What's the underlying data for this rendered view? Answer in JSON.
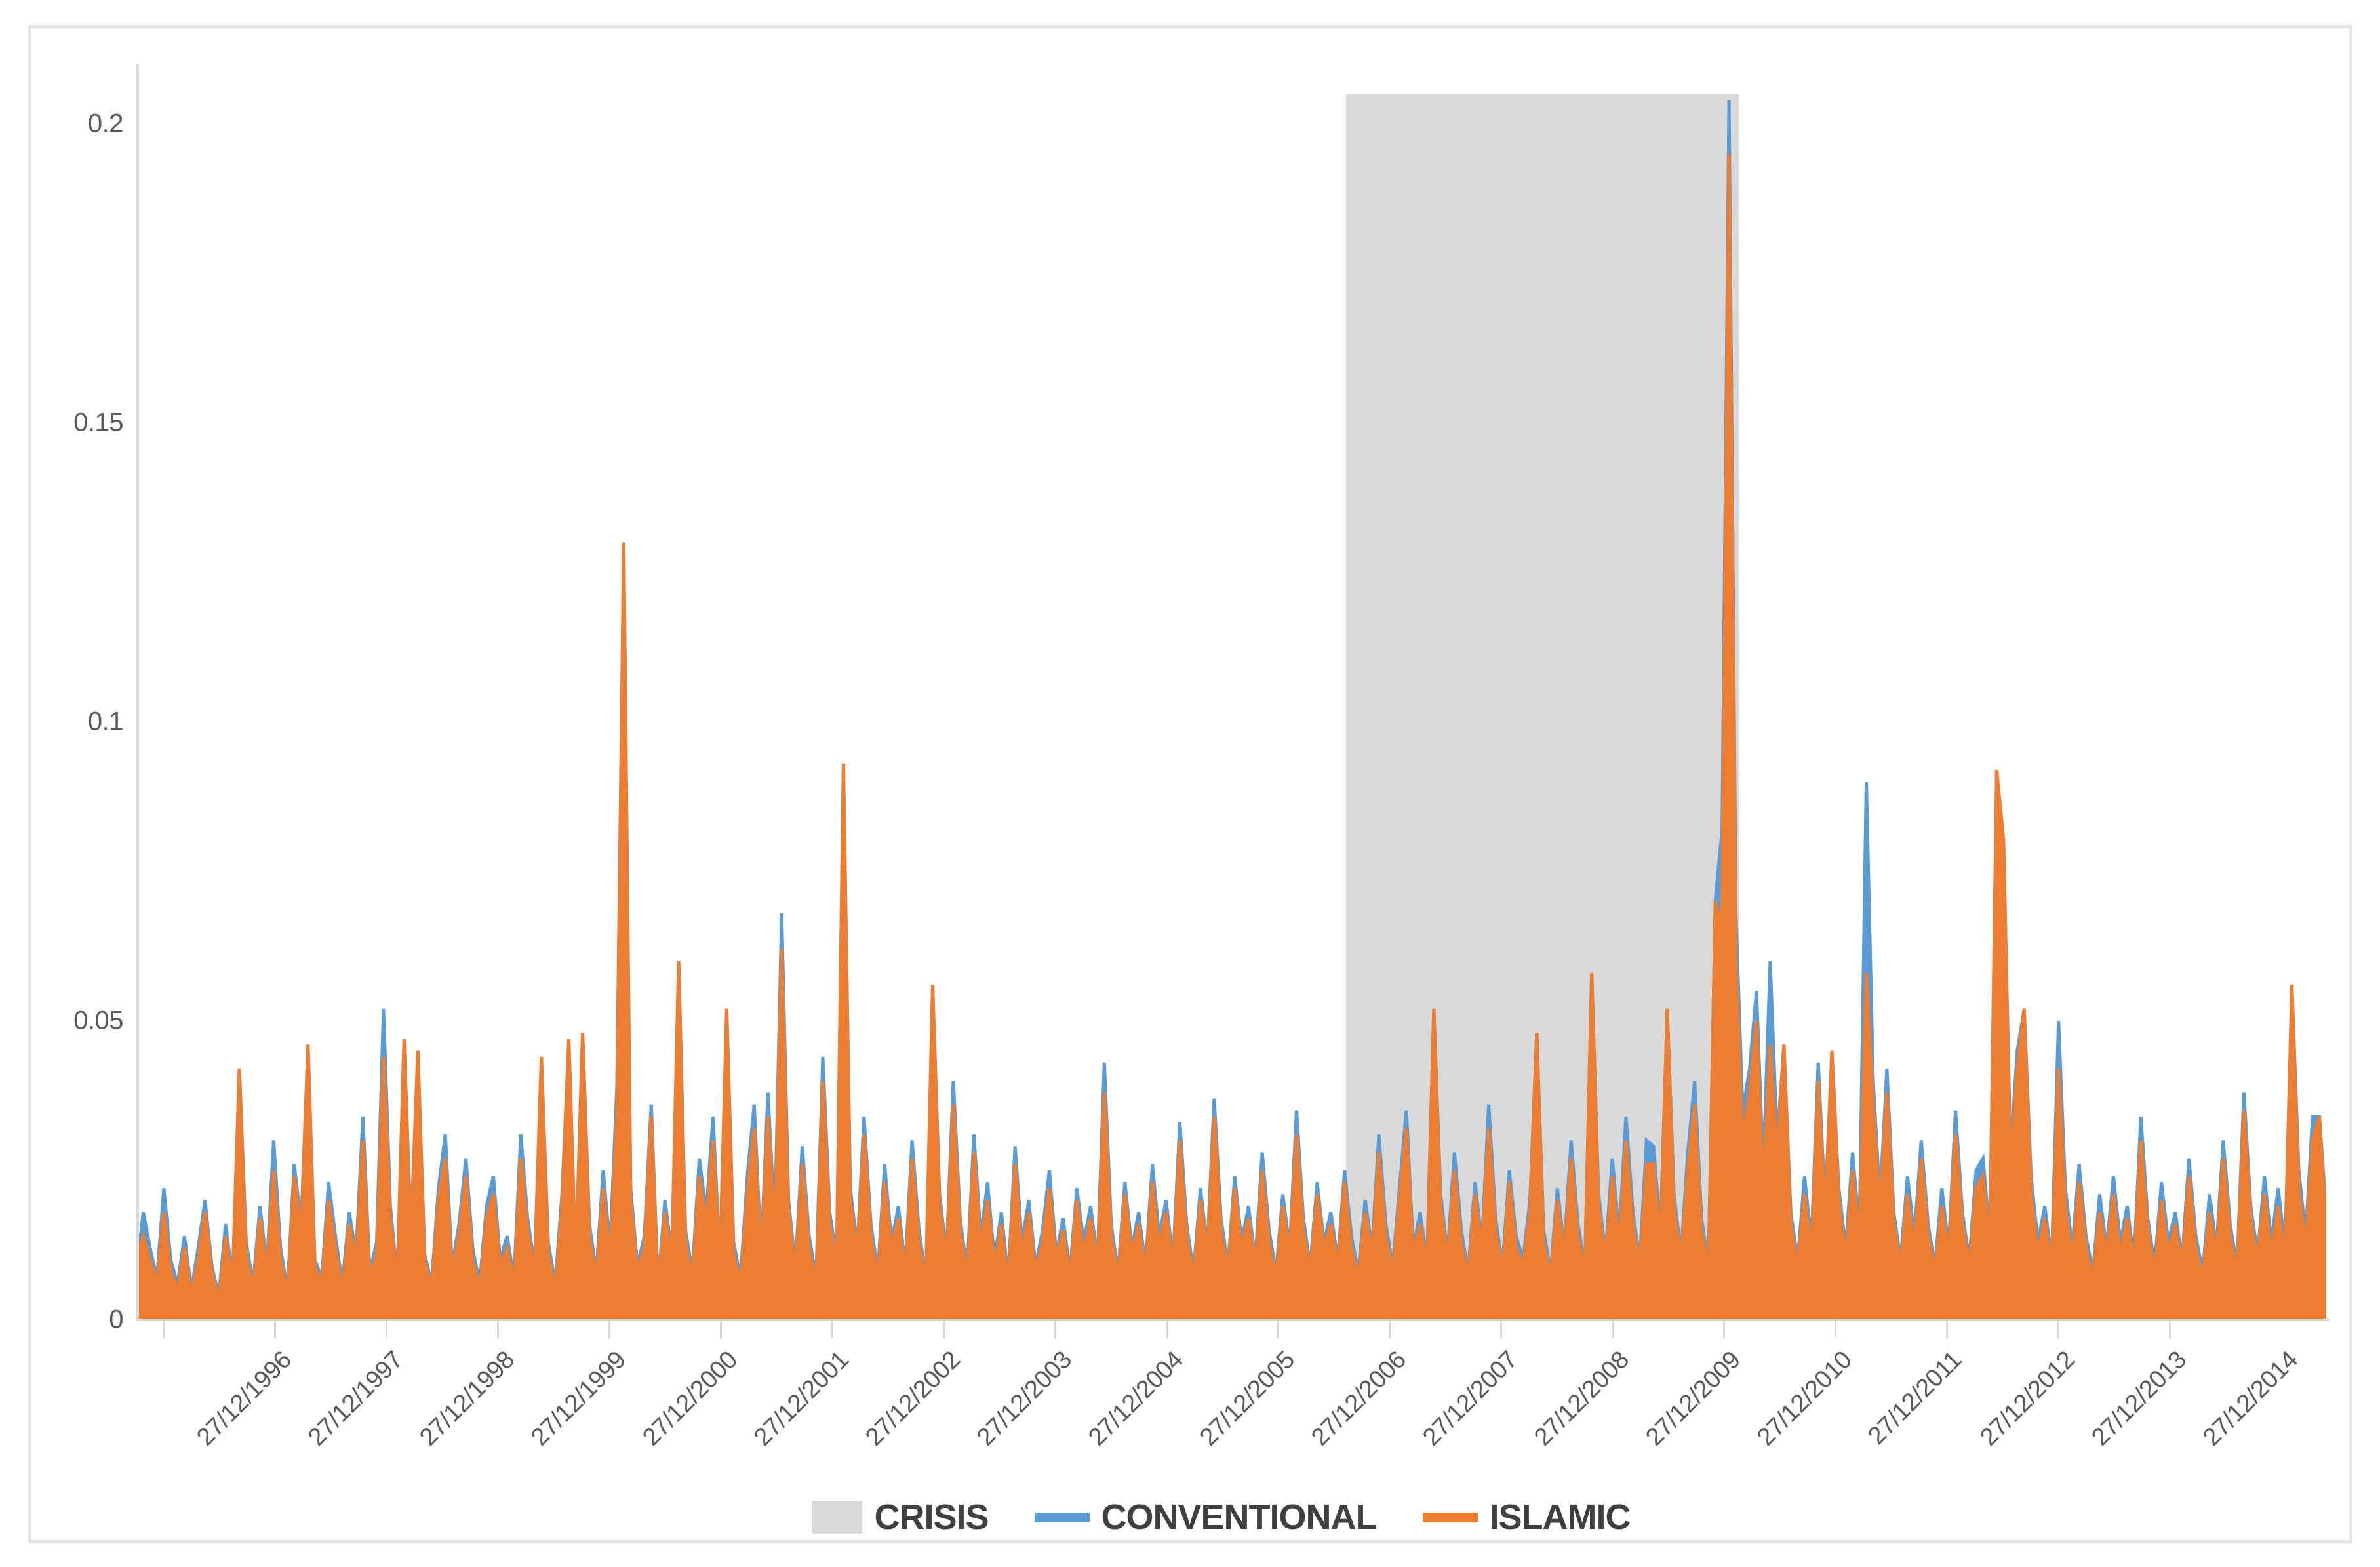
{
  "chart_data": {
    "type": "line",
    "title": "",
    "xlabel": "",
    "ylabel": "",
    "ylim": [
      0,
      0.21
    ],
    "grid": false,
    "legend_position": "bottom",
    "y_ticks": [
      "0",
      "0.05",
      "0.1",
      "0.15",
      "0.2"
    ],
    "y_tick_values": [
      0,
      0.05,
      0.1,
      0.15,
      0.2
    ],
    "x_tick_labels": [
      "27/12/1996",
      "27/12/1997",
      "27/12/1998",
      "27/12/1999",
      "27/12/2000",
      "27/12/2001",
      "27/12/2002",
      "27/12/2003",
      "27/12/2004",
      "27/12/2005",
      "27/12/2006",
      "27/12/2007",
      "27/12/2008",
      "27/12/2009",
      "27/12/2010",
      "27/12/2011",
      "27/12/2012",
      "27/12/2013",
      "27/12/2014"
    ],
    "shaded_region": {
      "name": "CRISIS",
      "label": "CRISIS",
      "color": "#d9d9d9",
      "x_start_label": "mid 2007",
      "x_end_label": "mid 2010",
      "y_top": 0.205
    },
    "series": [
      {
        "name": "CONVENTIONAL",
        "label": "CONVENTIONAL",
        "color": "#5b9bd5",
        "max_value": 0.204,
        "max_value_at": "early 2008",
        "values": [
          0.008,
          0.018,
          0.012,
          0.007,
          0.022,
          0.01,
          0.006,
          0.014,
          0.005,
          0.012,
          0.02,
          0.009,
          0.004,
          0.016,
          0.007,
          0.042,
          0.013,
          0.006,
          0.019,
          0.009,
          0.03,
          0.012,
          0.005,
          0.026,
          0.016,
          0.046,
          0.01,
          0.007,
          0.023,
          0.014,
          0.006,
          0.018,
          0.011,
          0.034,
          0.008,
          0.013,
          0.052,
          0.019,
          0.007,
          0.047,
          0.015,
          0.045,
          0.011,
          0.006,
          0.022,
          0.031,
          0.009,
          0.016,
          0.027,
          0.012,
          0.006,
          0.019,
          0.024,
          0.01,
          0.014,
          0.007,
          0.031,
          0.017,
          0.009,
          0.044,
          0.013,
          0.006,
          0.021,
          0.047,
          0.01,
          0.048,
          0.016,
          0.008,
          0.025,
          0.012,
          0.039,
          0.13,
          0.022,
          0.009,
          0.014,
          0.036,
          0.006,
          0.02,
          0.011,
          0.06,
          0.015,
          0.008,
          0.027,
          0.018,
          0.034,
          0.01,
          0.052,
          0.013,
          0.007,
          0.024,
          0.036,
          0.011,
          0.038,
          0.016,
          0.068,
          0.02,
          0.009,
          0.029,
          0.014,
          0.007,
          0.044,
          0.018,
          0.01,
          0.093,
          0.022,
          0.012,
          0.034,
          0.016,
          0.008,
          0.026,
          0.013,
          0.019,
          0.009,
          0.03,
          0.015,
          0.007,
          0.056,
          0.021,
          0.011,
          0.04,
          0.017,
          0.008,
          0.031,
          0.014,
          0.023,
          0.01,
          0.018,
          0.007,
          0.029,
          0.013,
          0.02,
          0.009,
          0.015,
          0.025,
          0.011,
          0.017,
          0.008,
          0.022,
          0.013,
          0.019,
          0.01,
          0.043,
          0.016,
          0.008,
          0.023,
          0.012,
          0.018,
          0.009,
          0.026,
          0.014,
          0.02,
          0.01,
          0.033,
          0.016,
          0.008,
          0.022,
          0.012,
          0.037,
          0.017,
          0.009,
          0.024,
          0.013,
          0.019,
          0.01,
          0.028,
          0.015,
          0.008,
          0.021,
          0.012,
          0.035,
          0.017,
          0.009,
          0.023,
          0.013,
          0.018,
          0.01,
          0.025,
          0.014,
          0.008,
          0.02,
          0.012,
          0.031,
          0.016,
          0.009,
          0.022,
          0.035,
          0.012,
          0.018,
          0.01,
          0.052,
          0.021,
          0.011,
          0.028,
          0.015,
          0.008,
          0.023,
          0.013,
          0.036,
          0.017,
          0.009,
          0.025,
          0.014,
          0.01,
          0.02,
          0.048,
          0.015,
          0.008,
          0.022,
          0.012,
          0.03,
          0.016,
          0.009,
          0.058,
          0.021,
          0.011,
          0.027,
          0.014,
          0.034,
          0.018,
          0.01,
          0.03,
          0.029,
          0.015,
          0.052,
          0.021,
          0.011,
          0.028,
          0.04,
          0.017,
          0.009,
          0.07,
          0.082,
          0.204,
          0.068,
          0.035,
          0.042,
          0.055,
          0.025,
          0.06,
          0.03,
          0.046,
          0.018,
          0.01,
          0.024,
          0.013,
          0.043,
          0.019,
          0.045,
          0.022,
          0.012,
          0.028,
          0.015,
          0.09,
          0.04,
          0.02,
          0.042,
          0.018,
          0.01,
          0.024,
          0.014,
          0.03,
          0.016,
          0.009,
          0.022,
          0.012,
          0.035,
          0.018,
          0.01,
          0.025,
          0.027,
          0.014,
          0.092,
          0.08,
          0.028,
          0.045,
          0.052,
          0.024,
          0.013,
          0.019,
          0.01,
          0.05,
          0.022,
          0.012,
          0.026,
          0.014,
          0.008,
          0.021,
          0.012,
          0.024,
          0.013,
          0.019,
          0.01,
          0.034,
          0.017,
          0.009,
          0.023,
          0.013,
          0.018,
          0.01,
          0.027,
          0.014,
          0.008,
          0.021,
          0.012,
          0.03,
          0.016,
          0.009,
          0.038,
          0.019,
          0.011,
          0.024,
          0.013,
          0.022,
          0.012,
          0.056,
          0.025,
          0.014,
          0.034,
          0.034,
          0.018
        ]
      },
      {
        "name": "ISLAMIC",
        "label": "ISLAMIC",
        "color": "#ed7d31",
        "max_value": 0.195,
        "max_value_at": "early 2008",
        "values": [
          0.01,
          0.014,
          0.01,
          0.006,
          0.018,
          0.008,
          0.005,
          0.012,
          0.004,
          0.01,
          0.018,
          0.008,
          0.003,
          0.014,
          0.006,
          0.042,
          0.011,
          0.005,
          0.017,
          0.008,
          0.025,
          0.01,
          0.004,
          0.024,
          0.014,
          0.046,
          0.009,
          0.006,
          0.02,
          0.012,
          0.005,
          0.016,
          0.01,
          0.03,
          0.007,
          0.011,
          0.044,
          0.017,
          0.006,
          0.047,
          0.013,
          0.045,
          0.01,
          0.005,
          0.02,
          0.027,
          0.008,
          0.014,
          0.024,
          0.01,
          0.005,
          0.017,
          0.021,
          0.009,
          0.012,
          0.006,
          0.027,
          0.015,
          0.008,
          0.044,
          0.011,
          0.005,
          0.019,
          0.047,
          0.009,
          0.048,
          0.014,
          0.007,
          0.022,
          0.01,
          0.034,
          0.13,
          0.02,
          0.008,
          0.012,
          0.034,
          0.005,
          0.018,
          0.01,
          0.06,
          0.013,
          0.007,
          0.024,
          0.016,
          0.03,
          0.009,
          0.052,
          0.011,
          0.006,
          0.021,
          0.032,
          0.01,
          0.034,
          0.014,
          0.062,
          0.018,
          0.008,
          0.026,
          0.012,
          0.006,
          0.04,
          0.016,
          0.009,
          0.093,
          0.02,
          0.011,
          0.031,
          0.014,
          0.007,
          0.023,
          0.012,
          0.017,
          0.008,
          0.027,
          0.013,
          0.006,
          0.056,
          0.019,
          0.01,
          0.036,
          0.015,
          0.007,
          0.028,
          0.012,
          0.02,
          0.009,
          0.016,
          0.006,
          0.026,
          0.011,
          0.018,
          0.008,
          0.013,
          0.022,
          0.01,
          0.015,
          0.007,
          0.02,
          0.011,
          0.017,
          0.009,
          0.038,
          0.014,
          0.007,
          0.021,
          0.011,
          0.016,
          0.008,
          0.023,
          0.012,
          0.018,
          0.009,
          0.03,
          0.014,
          0.007,
          0.02,
          0.011,
          0.034,
          0.015,
          0.008,
          0.022,
          0.012,
          0.017,
          0.009,
          0.025,
          0.013,
          0.007,
          0.019,
          0.011,
          0.031,
          0.015,
          0.008,
          0.021,
          0.012,
          0.016,
          0.009,
          0.023,
          0.012,
          0.007,
          0.018,
          0.011,
          0.028,
          0.014,
          0.008,
          0.02,
          0.032,
          0.011,
          0.016,
          0.009,
          0.052,
          0.019,
          0.01,
          0.025,
          0.013,
          0.007,
          0.021,
          0.012,
          0.032,
          0.015,
          0.008,
          0.023,
          0.012,
          0.009,
          0.018,
          0.048,
          0.013,
          0.007,
          0.02,
          0.011,
          0.027,
          0.014,
          0.008,
          0.058,
          0.019,
          0.01,
          0.024,
          0.012,
          0.03,
          0.016,
          0.009,
          0.026,
          0.026,
          0.013,
          0.052,
          0.019,
          0.01,
          0.025,
          0.036,
          0.015,
          0.008,
          0.07,
          0.066,
          0.195,
          0.06,
          0.03,
          0.038,
          0.05,
          0.022,
          0.046,
          0.027,
          0.046,
          0.016,
          0.009,
          0.021,
          0.011,
          0.04,
          0.017,
          0.045,
          0.02,
          0.01,
          0.025,
          0.013,
          0.058,
          0.036,
          0.018,
          0.038,
          0.016,
          0.009,
          0.021,
          0.012,
          0.027,
          0.014,
          0.008,
          0.019,
          0.011,
          0.031,
          0.016,
          0.009,
          0.022,
          0.024,
          0.012,
          0.092,
          0.08,
          0.025,
          0.042,
          0.052,
          0.021,
          0.011,
          0.017,
          0.009,
          0.042,
          0.019,
          0.01,
          0.023,
          0.012,
          0.007,
          0.018,
          0.011,
          0.021,
          0.011,
          0.017,
          0.009,
          0.03,
          0.015,
          0.008,
          0.02,
          0.011,
          0.016,
          0.009,
          0.024,
          0.012,
          0.007,
          0.018,
          0.011,
          0.027,
          0.014,
          0.008,
          0.035,
          0.017,
          0.01,
          0.021,
          0.011,
          0.019,
          0.01,
          0.056,
          0.022,
          0.012,
          0.03,
          0.034,
          0.016
        ]
      }
    ]
  },
  "legend": {
    "items": [
      {
        "label": "CRISIS",
        "icon": "filled-square-swatch",
        "color": "#d9d9d9"
      },
      {
        "label": "CONVENTIONAL",
        "icon": "line-swatch",
        "color": "#5b9bd5"
      },
      {
        "label": "ISLAMIC",
        "icon": "line-swatch",
        "color": "#ed7d31"
      }
    ]
  },
  "axis": {
    "y_label_color": "#595959",
    "x_label_color": "#595959",
    "line_color": "#d9d9d9"
  }
}
